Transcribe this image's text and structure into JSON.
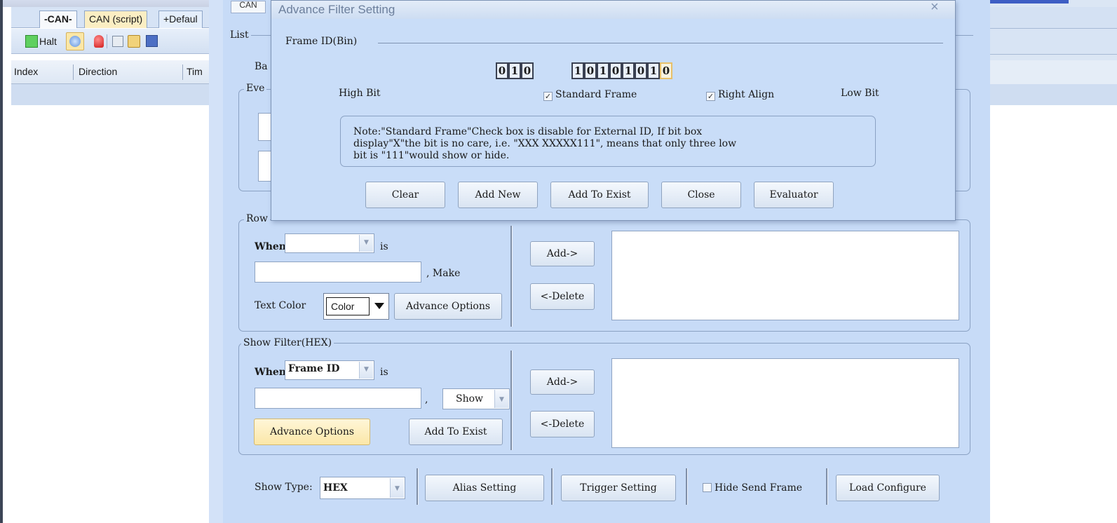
{
  "app_tabs": [
    "-CAN-",
    "CAN (script)",
    "+Defaul"
  ],
  "toolbar": {
    "halt_label": "Halt"
  },
  "columns": [
    "Index",
    "Direction",
    "Tim"
  ],
  "main_dialog": {
    "partial_labels": {
      "list": "List",
      "ba": "Ba",
      "eve": "Eve",
      "row": "Row"
    },
    "row_color": {
      "when_label": "When",
      "is_label": "is",
      "make_label": ", Make",
      "text_color_label": "Text Color",
      "color_value": "Color",
      "advance_options": "Advance Options",
      "add_btn": "Add->",
      "delete_btn": "<-Delete"
    },
    "show_filter": {
      "title": "Show Filter(HEX)",
      "when_label": "When",
      "when_value": "Frame ID",
      "is_label": "is",
      "comma": ",",
      "show_value": "Show",
      "advance_options": "Advance Options",
      "add_to_exist": "Add To Exist",
      "add_btn": "Add->",
      "delete_btn": "<-Delete"
    },
    "bottom": {
      "show_type_label": "Show Type:",
      "show_type_value": "HEX",
      "alias_setting": "Alias Setting",
      "trigger_setting": "Trigger Setting",
      "hide_send_frame": "Hide Send Frame",
      "load_configure": "Load Configure"
    }
  },
  "overlay": {
    "title": "Advance Filter Setting",
    "tab_fragment": "CAN",
    "close_glyph": "×",
    "frame_id_label": "Frame ID(Bin)",
    "bits": [
      "0",
      "1",
      "0",
      "1",
      "0",
      "1",
      "0",
      "1",
      "0",
      "1",
      "0"
    ],
    "high_bit": "High Bit",
    "low_bit": "Low Bit",
    "standard_frame": "Standard Frame",
    "right_align": "Right Align",
    "note_lines": [
      "Note:\"Standard Frame\"Check box is disable for External ID, If bit box",
      "display\"X\"the  bit is no care, i.e. \"XXX XXXXX111\", means that only three low",
      "bit is \"111\"would show or hide."
    ],
    "buttons": [
      "Clear",
      "Add New",
      "Add To Exist",
      "Close",
      "Evaluator"
    ]
  }
}
